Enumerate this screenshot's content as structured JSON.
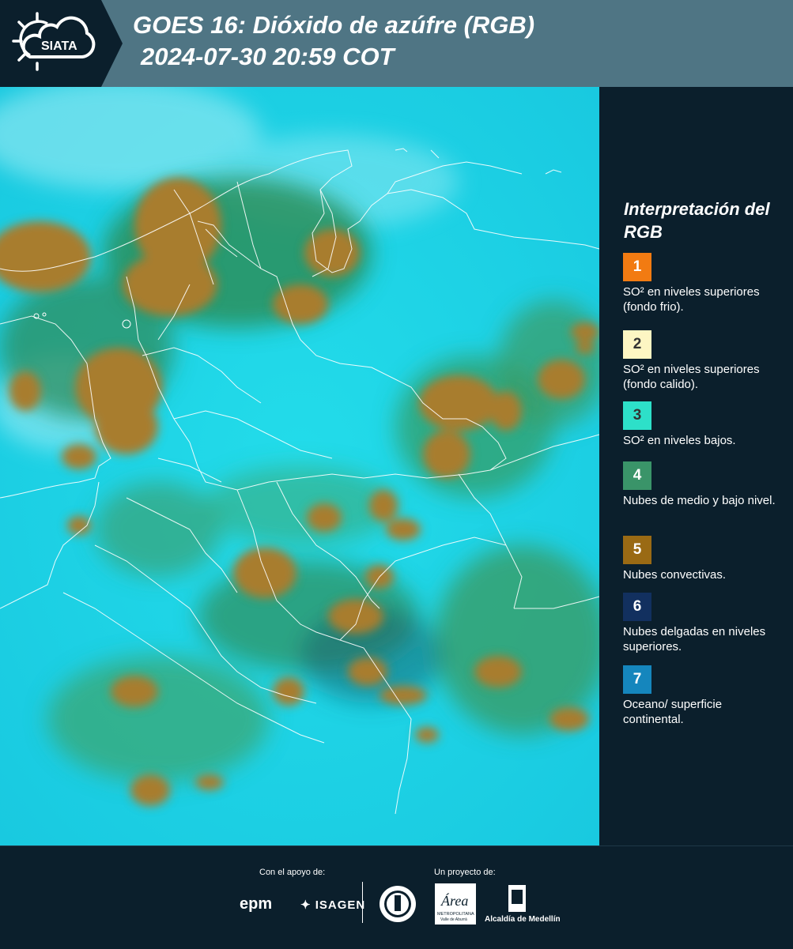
{
  "header": {
    "logo_text": "SIATA",
    "title_line1": "GOES 16: Dióxido de azúfre (RGB)",
    "title_line2": "2024-07-30 20:59 COT"
  },
  "legend": {
    "title": "Interpretación del RGB",
    "items": [
      {
        "number": "1",
        "color": "#f27b12",
        "label": "SO² en niveles superiores (fondo frio)."
      },
      {
        "number": "2",
        "color": "#fdf6c3",
        "label": "SO² en niveles superiores (fondo calido)."
      },
      {
        "number": "3",
        "color": "#2de0c9",
        "label": "SO² en niveles bajos."
      },
      {
        "number": "4",
        "color": "#3a9469",
        "label": "Nubes de medio y bajo nivel."
      },
      {
        "number": "5",
        "color": "#9a6a14",
        "label": "Nubes convectivas."
      },
      {
        "number": "6",
        "color": "#12305f",
        "label": "Nubes delgadas en niveles superiores."
      },
      {
        "number": "7",
        "color": "#1586bd",
        "label": "Oceano/ superficie continental."
      }
    ]
  },
  "footer": {
    "support_label": "Con el apoyo de:",
    "project_label": "Un proyecto de:",
    "sponsors": [
      "epm",
      "ISAGEN"
    ],
    "area_logo_text": "Área",
    "area_subtext": "METROPOLITANA",
    "area_subtext2": "Valle de Aburrá",
    "alcaldia_text": "Alcaldía de Medellín"
  },
  "colors": {
    "header_bg": "#4f7584",
    "panel_bg": "#0b1f2c",
    "map_background": "#1fd6e6",
    "convective_cloud": "#a67d2c",
    "mid_low_cloud": "#2e8a58"
  }
}
